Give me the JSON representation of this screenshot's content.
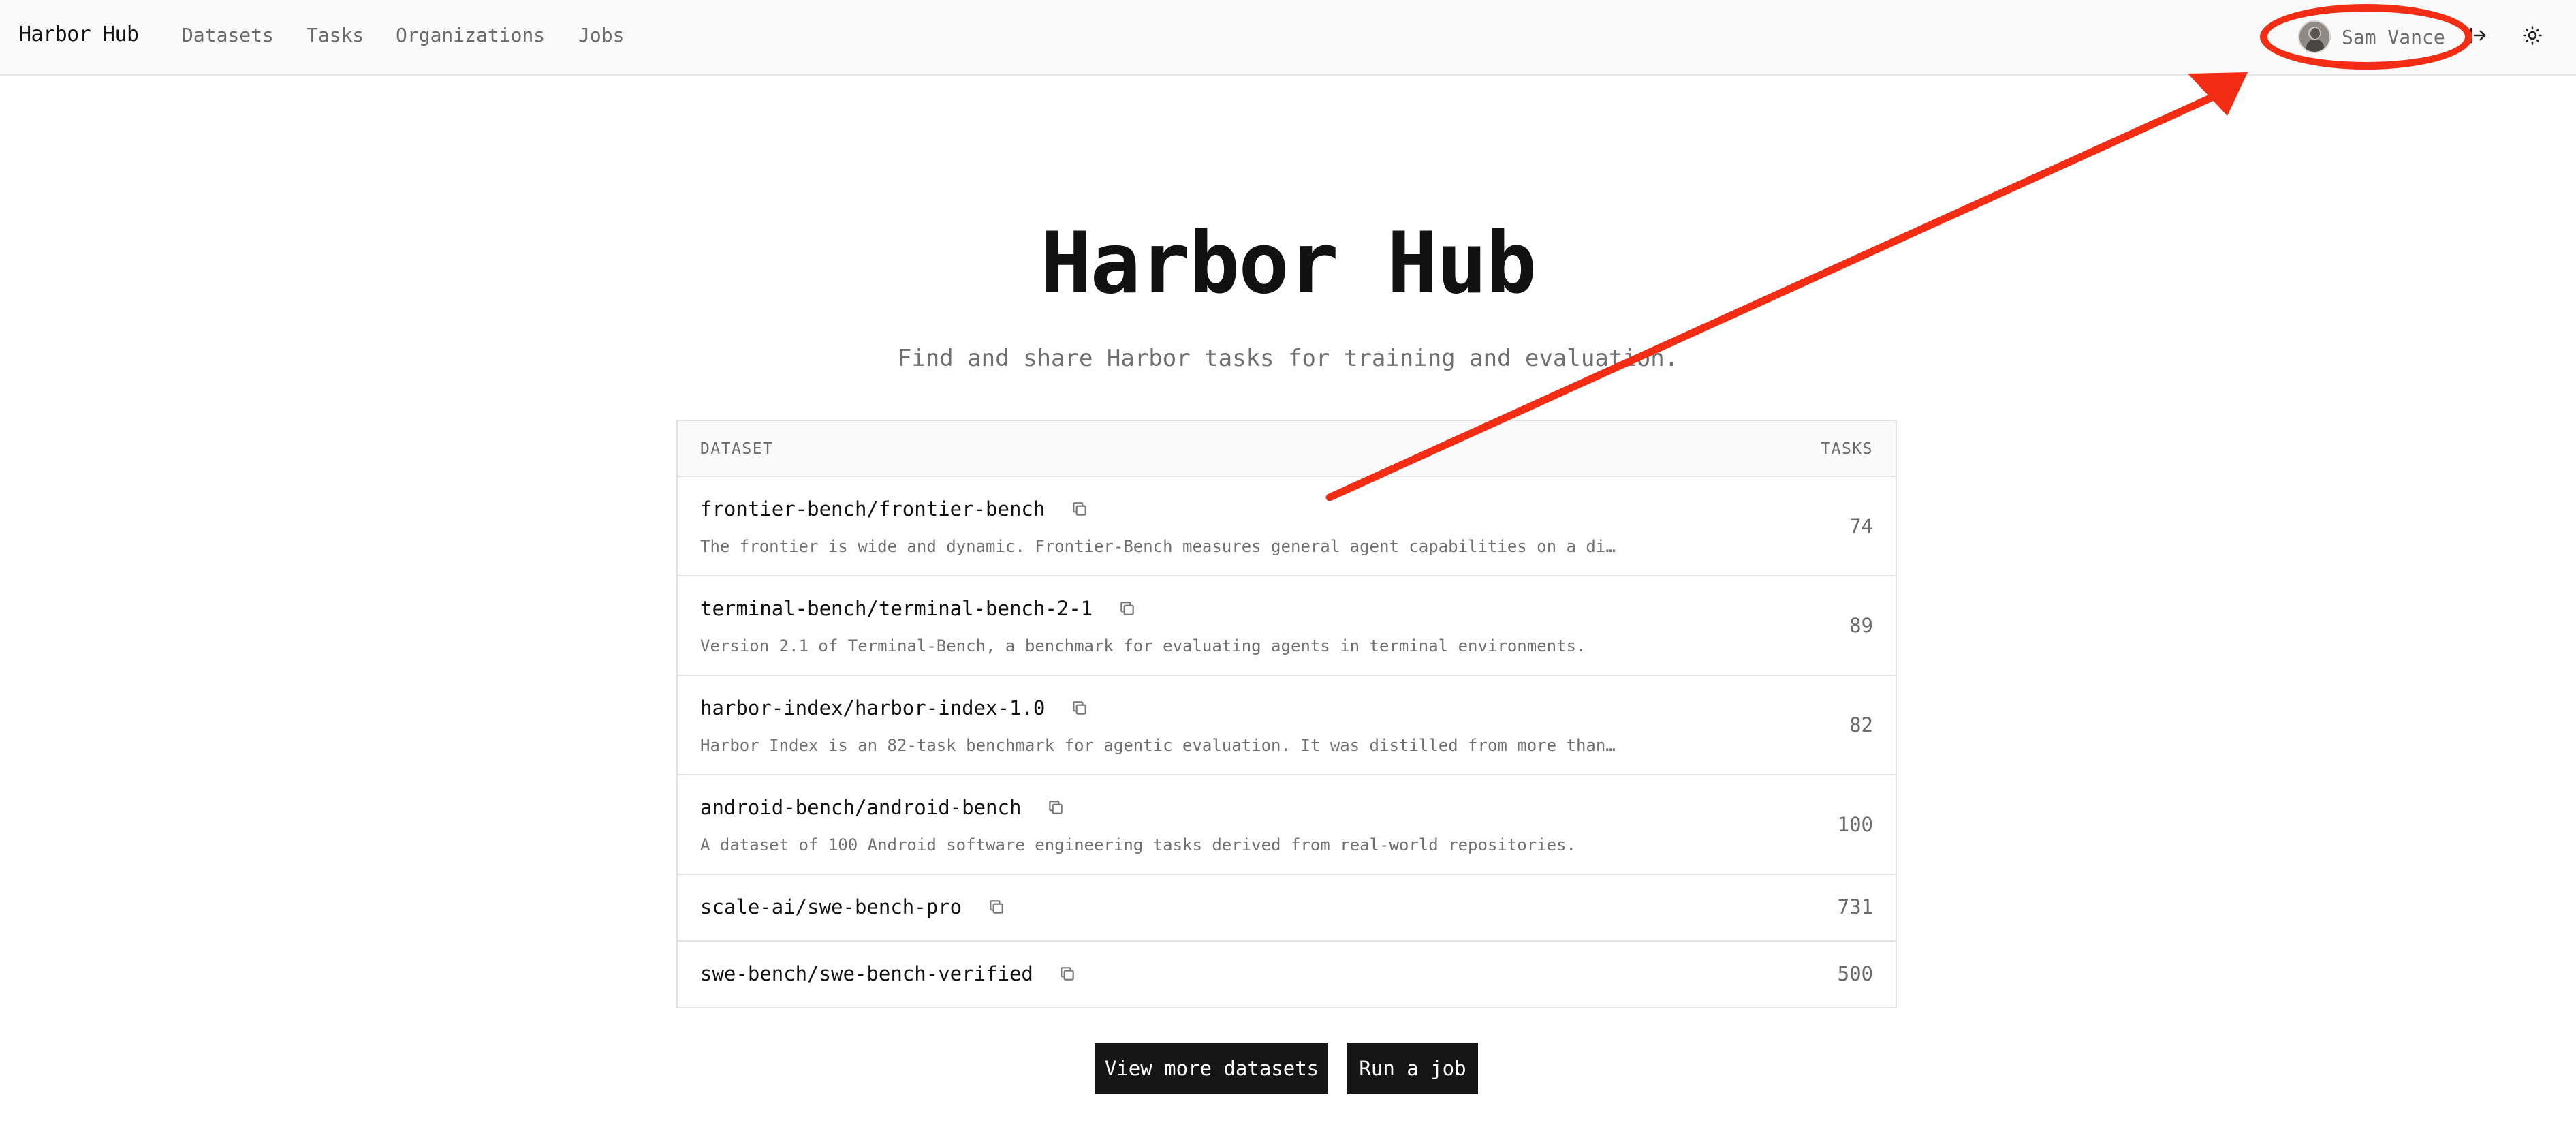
{
  "nav": {
    "brand": "Harbor Hub",
    "links": [
      "Datasets",
      "Tasks",
      "Organizations",
      "Jobs"
    ],
    "user_name": "Sam Vance",
    "icons": {
      "avatar": "user-avatar",
      "logout": "logout-arrow-icon",
      "theme": "sun-icon"
    }
  },
  "hero": {
    "title": "Harbor Hub",
    "subtitle": "Find and share Harbor tasks for training and evaluation."
  },
  "table": {
    "headers": {
      "dataset": "DATASET",
      "tasks": "TASKS"
    },
    "rows": [
      {
        "name": "frontier-bench/frontier-bench",
        "description": "The frontier is wide and dynamic. Frontier-Bench measures general agent capabilities on a di…",
        "tasks": "74"
      },
      {
        "name": "terminal-bench/terminal-bench-2-1",
        "description": "Version 2.1 of Terminal-Bench, a benchmark for evaluating agents in terminal environments.",
        "tasks": "89"
      },
      {
        "name": "harbor-index/harbor-index-1.0",
        "description": "Harbor Index is an 82-task benchmark for agentic evaluation. It was distilled from more than…",
        "tasks": "82"
      },
      {
        "name": "android-bench/android-bench",
        "description": "A dataset of 100 Android software engineering tasks derived from real-world repositories.",
        "tasks": "100"
      },
      {
        "name": "scale-ai/swe-bench-pro",
        "description": "",
        "tasks": "731"
      },
      {
        "name": "swe-bench/swe-bench-verified",
        "description": "",
        "tasks": "500"
      }
    ]
  },
  "actions": {
    "view_more": "View more datasets",
    "run_job": "Run a job"
  },
  "annotation": {
    "color": "#f32d14"
  }
}
